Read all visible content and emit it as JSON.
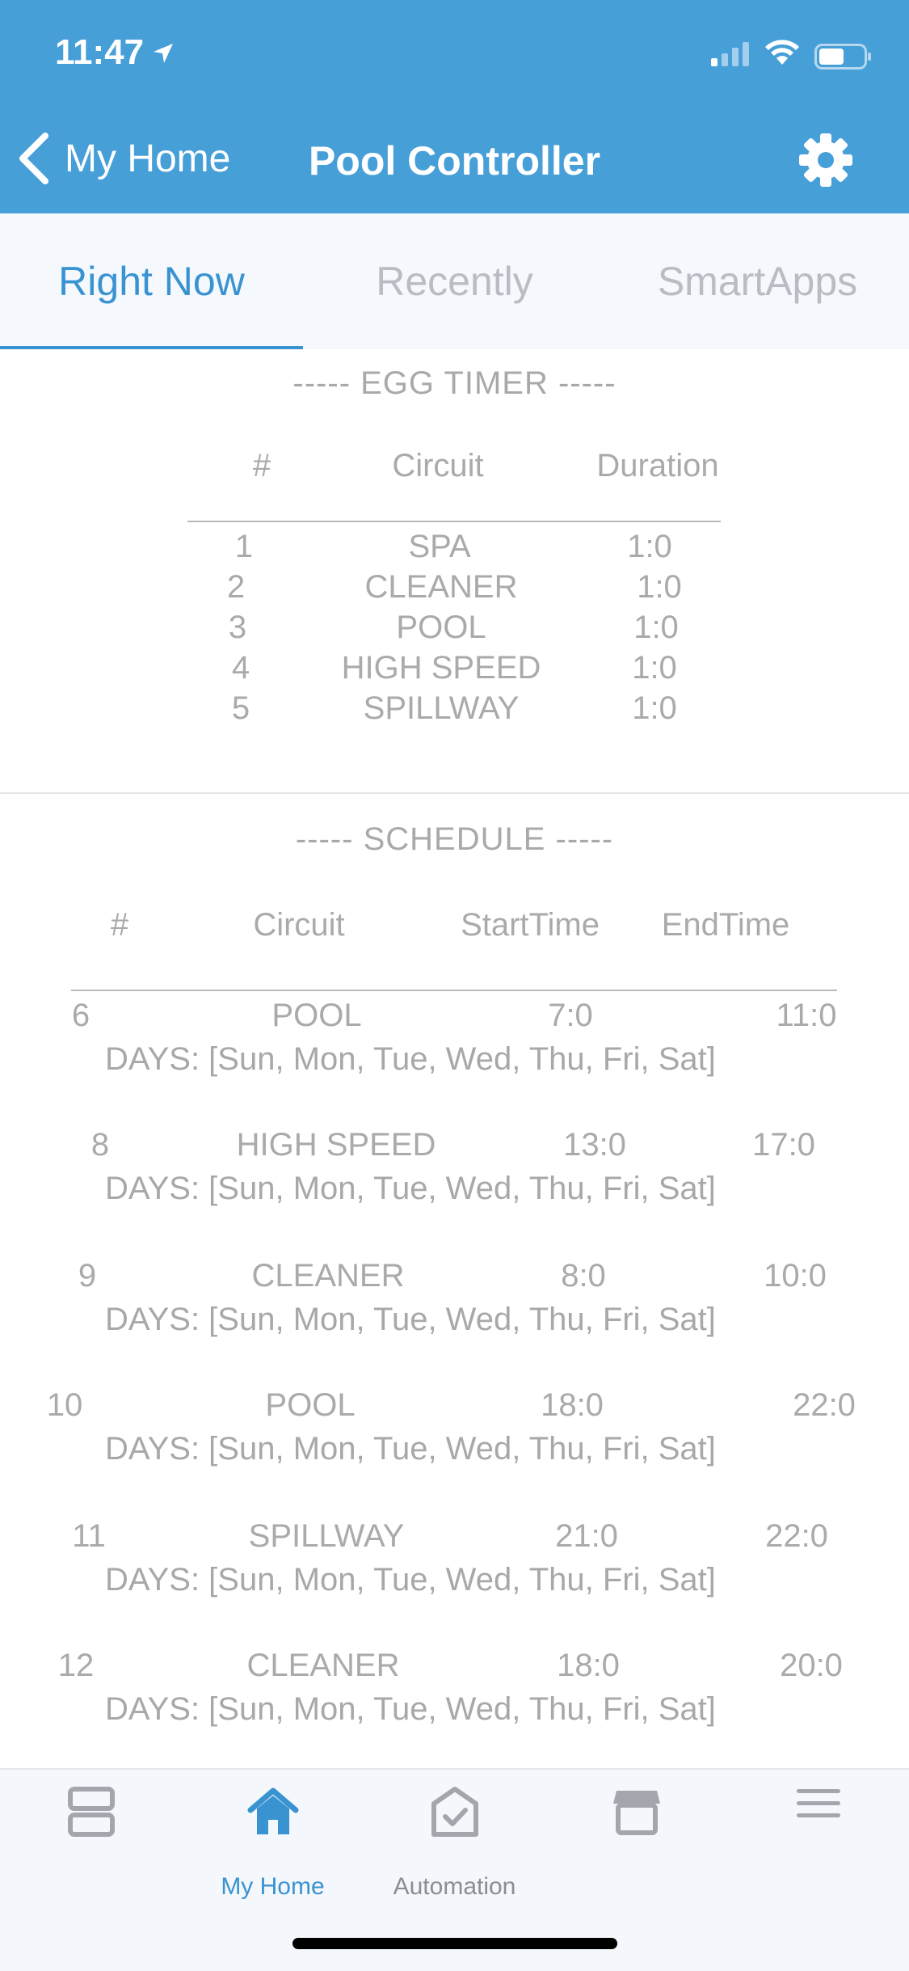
{
  "status_bar": {
    "time": "11:47"
  },
  "header": {
    "back_label": "My Home",
    "title": "Pool Controller"
  },
  "tabs": [
    {
      "label": "Right Now",
      "active": true
    },
    {
      "label": "Recently",
      "active": false
    },
    {
      "label": "SmartApps",
      "active": false
    }
  ],
  "egg_timer": {
    "title": "----- EGG TIMER -----",
    "headers": {
      "num": "#",
      "circuit": "Circuit",
      "duration": "Duration"
    },
    "rows": [
      {
        "num": "1",
        "circuit": "SPA",
        "duration": "1:0"
      },
      {
        "num": "2",
        "circuit": "CLEANER",
        "duration": "1:0"
      },
      {
        "num": "3",
        "circuit": "POOL",
        "duration": "1:0"
      },
      {
        "num": "4",
        "circuit": "HIGH SPEED",
        "duration": "1:0"
      },
      {
        "num": "5",
        "circuit": "SPILLWAY",
        "duration": "1:0"
      }
    ]
  },
  "schedule": {
    "title": "----- SCHEDULE -----",
    "headers": {
      "num": "#",
      "circuit": "Circuit",
      "start": "StartTime",
      "end": "EndTime"
    },
    "rows": [
      {
        "num": "6",
        "circuit": "POOL",
        "start": "7:0",
        "end": "11:0",
        "days": "DAYS: [Sun, Mon, Tue, Wed, Thu, Fri, Sat]"
      },
      {
        "num": "8",
        "circuit": "HIGH SPEED",
        "start": "13:0",
        "end": "17:0",
        "days": "DAYS: [Sun, Mon, Tue, Wed, Thu, Fri, Sat]"
      },
      {
        "num": "9",
        "circuit": "CLEANER",
        "start": "8:0",
        "end": "10:0",
        "days": "DAYS: [Sun, Mon, Tue, Wed, Thu, Fri, Sat]"
      },
      {
        "num": "10",
        "circuit": "POOL",
        "start": "18:0",
        "end": "22:0",
        "days": "DAYS: [Sun, Mon, Tue, Wed, Thu, Fri, Sat]"
      },
      {
        "num": "11",
        "circuit": "SPILLWAY",
        "start": "21:0",
        "end": "22:0",
        "days": "DAYS: [Sun, Mon, Tue, Wed, Thu, Fri, Sat]"
      },
      {
        "num": "12",
        "circuit": "CLEANER",
        "start": "18:0",
        "end": "20:0",
        "days": "DAYS: [Sun, Mon, Tue, Wed, Thu, Fri, Sat]"
      }
    ]
  },
  "bottom_nav": {
    "items": [
      {
        "label": "",
        "icon": "dashboard-icon",
        "active": false
      },
      {
        "label": "My Home",
        "icon": "home-icon",
        "active": true
      },
      {
        "label": "Automation",
        "icon": "automation-icon",
        "active": false
      },
      {
        "label": "",
        "icon": "marketplace-icon",
        "active": false
      },
      {
        "label": "",
        "icon": "menu-icon",
        "active": false
      }
    ]
  },
  "colors": {
    "header": "#479fd8",
    "accent": "#3a93d1",
    "muted_text": "#aaaaaa"
  }
}
